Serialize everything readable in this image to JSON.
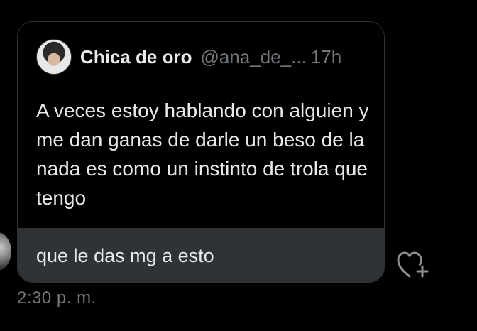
{
  "quoted_tweet": {
    "author_name": "Chica de oro",
    "author_handle": "@ana_de_...",
    "age": "17h",
    "text": "A veces estoy hablando con alguien y me dan ganas de darle un beso de la nada es como un instinto de trola que tengo"
  },
  "message": {
    "text": "que le das mg a esto",
    "timestamp": "2:30 p. m."
  },
  "icons": {
    "reaction": "heart-plus-icon",
    "author_avatar": "profile-photo",
    "sender_avatar": "profile-photo"
  },
  "colors": {
    "background": "#000000",
    "bubble_fill": "#2f3336",
    "border": "#2f3336",
    "text_primary": "#e7e9ea",
    "text_secondary": "#71767b"
  }
}
